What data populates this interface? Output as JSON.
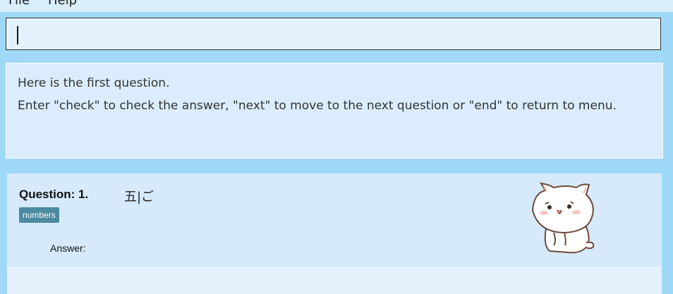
{
  "menubar": {
    "items": [
      "File",
      "Help"
    ]
  },
  "command_input": {
    "value": "",
    "placeholder": ""
  },
  "result": {
    "lines": [
      "Here is the first question.",
      "Enter \"check\" to check the answer, \"next\" to move to the next question or \"end\" to return to menu."
    ]
  },
  "question_card": {
    "label": "Question: 1.",
    "question": "五|ご",
    "tag": "numbers",
    "answer_label": "Answer:",
    "mascot": "white-cat-icon"
  },
  "colors": {
    "background": "#9fd9f7",
    "panel": "#dbedfc",
    "tag": "#4b8aa0"
  }
}
